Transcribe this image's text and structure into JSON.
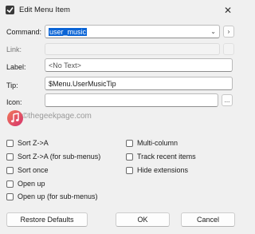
{
  "window": {
    "title": "Edit Menu Item",
    "close_glyph": "✕"
  },
  "fields": {
    "command": {
      "label": "Command:",
      "value": "user_music"
    },
    "link": {
      "label": "Link:",
      "value": ""
    },
    "label": {
      "label": "Label:",
      "placeholder": "<No Text>"
    },
    "tip": {
      "label": "Tip:",
      "value": "$Menu.UserMusicTip"
    },
    "icon": {
      "label": "Icon:",
      "value": ""
    }
  },
  "browse_label": "...",
  "watermark": "©thegeekpage.com",
  "checkboxes_left": [
    {
      "label": "Sort Z->A",
      "checked": false
    },
    {
      "label": "Sort Z->A (for sub-menus)",
      "checked": false
    },
    {
      "label": "Sort once",
      "checked": false
    },
    {
      "label": "Open up",
      "checked": false
    },
    {
      "label": "Open up (for sub-menus)",
      "checked": false
    }
  ],
  "checkboxes_right": [
    {
      "label": "Multi-column",
      "checked": false
    },
    {
      "label": "Track recent items",
      "checked": false
    },
    {
      "label": "Hide extensions",
      "checked": false
    }
  ],
  "buttons": {
    "restore": "Restore Defaults",
    "ok": "OK",
    "cancel": "Cancel"
  },
  "colors": {
    "selection": "#0a64d6",
    "music_icon": "#e0506a"
  }
}
